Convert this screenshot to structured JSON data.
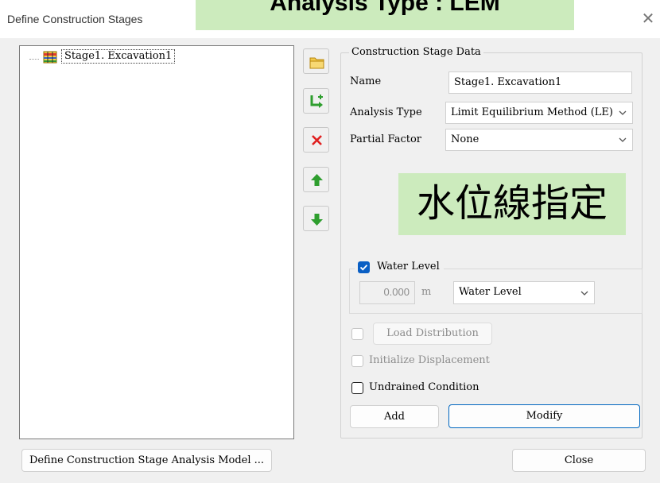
{
  "window": {
    "title": "Define Construction Stages",
    "close_glyph": "✕"
  },
  "overlays": {
    "top": "Analysis Type : LEM",
    "middle": "水位線指定"
  },
  "tree": {
    "items": [
      {
        "label": "Stage1. Excavation1",
        "icon": "stage-icon"
      }
    ]
  },
  "side_toolbar": [
    {
      "name": "folder-icon"
    },
    {
      "name": "insert-stage-icon"
    },
    {
      "name": "delete-icon"
    },
    {
      "name": "move-up-icon"
    },
    {
      "name": "move-down-icon"
    }
  ],
  "stage_data": {
    "group_title": "Construction Stage Data",
    "name_label": "Name",
    "name_value": "Stage1. Excavation1",
    "analysis_type_label": "Analysis Type",
    "analysis_type_value": "Limit Equilibrium Method (LE)",
    "partial_factor_label": "Partial Factor",
    "partial_factor_value": "None"
  },
  "water_level": {
    "checkbox_label": "Water Level",
    "checked": true,
    "value": "0.000",
    "unit": "m",
    "select_value": "Water Level"
  },
  "options": {
    "load_distribution": "Load Distribution",
    "initialize_displacement": "Initialize Displacement",
    "undrained_condition": "Undrained Condition"
  },
  "buttons": {
    "add": "Add",
    "modify": "Modify",
    "define_model": "Define Construction Stage Analysis Model ...",
    "close": "Close"
  },
  "colors": {
    "overlay_bg": "#ccebbd",
    "check_accent": "#0a5fc4",
    "focus_border": "#0067c0",
    "delete_red": "#e02020",
    "arrow_green": "#2e9e2e"
  }
}
